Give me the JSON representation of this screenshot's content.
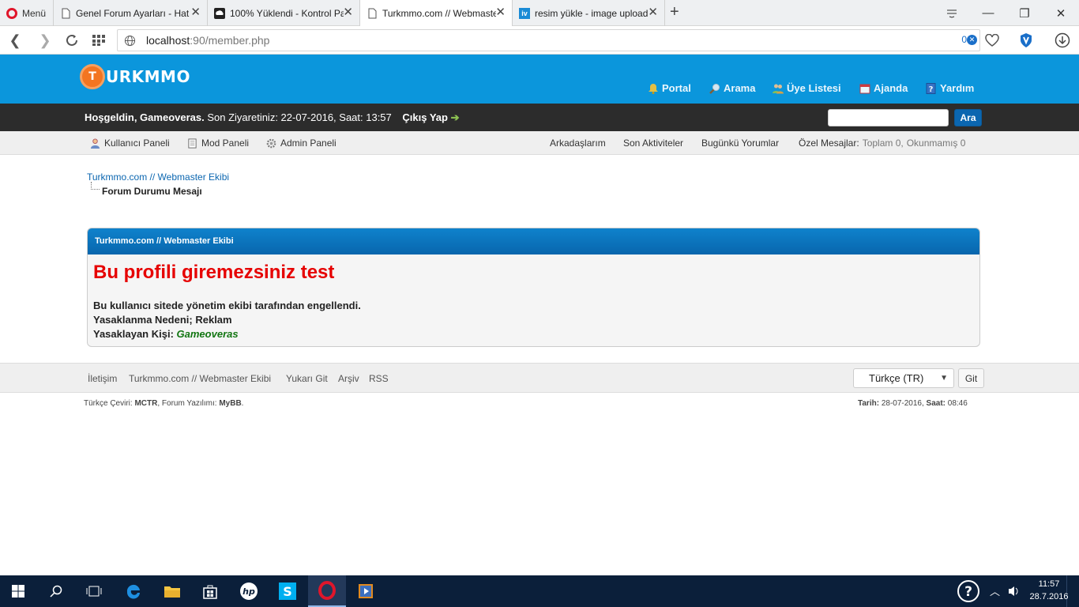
{
  "browser": {
    "menu_label": "Menü",
    "tabs": [
      {
        "title": "Genel Forum Ayarları - Hat",
        "icon": "page-icon"
      },
      {
        "title": "100% Yüklendi - Kontrol Pa",
        "icon": "upload-icon"
      },
      {
        "title": "Turkmmo.com // Webmaster",
        "icon": "page-icon",
        "active": true
      },
      {
        "title": "resim yükle - image upload",
        "icon": "iv-icon"
      }
    ],
    "url_host": "localhost",
    "url_rest": ":90/member.php",
    "adblock_count": "0"
  },
  "site": {
    "logo_text": "URKMMO",
    "logo_mark": "T",
    "nav": [
      {
        "label": "Portal",
        "icon": "bell-icon"
      },
      {
        "label": "Arama",
        "icon": "search-icon"
      },
      {
        "label": "Üye Listesi",
        "icon": "users-icon"
      },
      {
        "label": "Ajanda",
        "icon": "calendar-icon"
      },
      {
        "label": "Yardım",
        "icon": "help-icon"
      }
    ],
    "welcome": {
      "greeting": "Hoşgeldin, Gameoveras.",
      "last_visit": " Son Ziyaretiniz: 22-07-2016, Saat: 13:57",
      "logout": "Çıkış Yap"
    },
    "search_button": "Ara",
    "panels": [
      {
        "label": "Kullanıcı Paneli",
        "icon": "user-icon"
      },
      {
        "label": "Mod Paneli",
        "icon": "notepad-icon"
      },
      {
        "label": "Admin Paneli",
        "icon": "gear-icon"
      }
    ],
    "quick_links": [
      "Arkadaşlarım",
      "Son Aktiviteler",
      "Bugünkü Yorumlar"
    ],
    "pm": {
      "label": "Özel Mesajlar:",
      "total": "Toplam 0,",
      "unread": "Okunmamış 0"
    },
    "breadcrumb": {
      "root": "Turkmmo.com // Webmaster Ekibi",
      "current": "Forum Durumu Mesajı"
    },
    "message": {
      "header": "Turkmmo.com // Webmaster Ekibi",
      "title": "Bu profili giremezsiniz test",
      "line1": "Bu kullanıcı sitede yönetim ekibi tarafından engellendi.",
      "line2": "Yasaklanma Nedeni; Reklam",
      "line3_label": "Yasaklayan Kişi:",
      "line3_user": "Gameoveras"
    },
    "footer": {
      "links": [
        "İletişim",
        "Turkmmo.com // Webmaster Ekibi",
        "Yukarı Git",
        "Arşiv",
        "RSS"
      ],
      "language": "Türkçe (TR)",
      "go_button": "Git",
      "credits_a": "Türkçe Çeviri: ",
      "credits_b": "MCTR",
      "credits_c": ", Forum Yazılımı: ",
      "credits_d": "MyBB",
      "credits_e": ".",
      "date_label": "Tarih:",
      "date_value": " 28-07-2016, ",
      "time_label": "Saat:",
      "time_value": " 08:46"
    }
  },
  "taskbar": {
    "time": "11:57",
    "date": "28.7.2016"
  },
  "colors": {
    "header_blue": "#0b96dc",
    "title_red": "#e60000",
    "user_green": "#127612"
  }
}
